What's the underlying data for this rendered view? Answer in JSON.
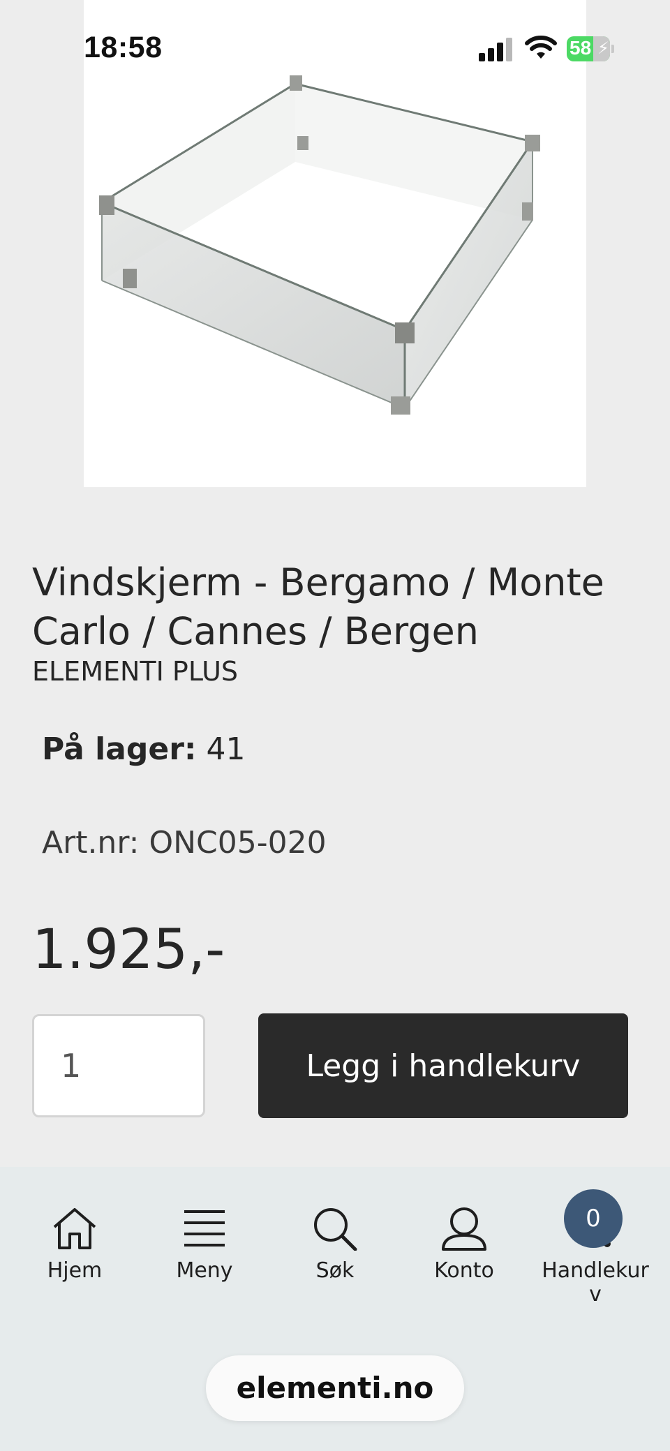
{
  "status_bar": {
    "time": "18:58",
    "battery": "58"
  },
  "product": {
    "title": "Vindskjerm - Bergamo / Monte Carlo / Cannes / Bergen",
    "brand": "ELEMENTI PLUS",
    "stock_label": "På lager:",
    "stock_value": "41",
    "sku": "Art.nr: ONC05-020",
    "price": "1.925,-",
    "image_icon": "glass-wind-screen-product-photo"
  },
  "purchase": {
    "quantity": "1",
    "add_to_cart_label": "Legg i handlekurv"
  },
  "bottom_nav": {
    "items": [
      {
        "label": "Hjem",
        "icon": "home-icon"
      },
      {
        "label": "Meny",
        "icon": "menu-icon"
      },
      {
        "label": "Søk",
        "icon": "search-icon"
      },
      {
        "label": "Konto",
        "icon": "user-icon"
      },
      {
        "label": "Handlekur\nv",
        "icon": "cart-icon"
      }
    ],
    "cart_count": "0"
  },
  "browser": {
    "domain": "elementi.no"
  },
  "colors": {
    "add_to_cart_bg": "#2a2a2a",
    "cart_badge_bg": "#3d5877",
    "battery_green": "#4cd964"
  }
}
